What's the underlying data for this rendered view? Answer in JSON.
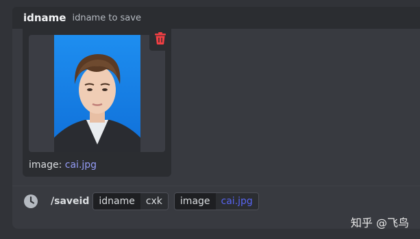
{
  "option_header": {
    "name": "idname",
    "description": "idname to save"
  },
  "attachment": {
    "caption_label": "image:",
    "caption_file": "cai.jpg"
  },
  "delete": {
    "icon": "trash-icon",
    "color": "#f23f43"
  },
  "command": {
    "icon": "clock-icon",
    "name": "/saveid",
    "options": [
      {
        "key": "idname",
        "value": "cxk"
      },
      {
        "key": "image",
        "value": "cai.jpg"
      }
    ]
  },
  "watermark": "知乎 @飞鸟",
  "colors": {
    "background": "#313338",
    "panel": "#383a40",
    "link": "#949cf7",
    "accent": "#5865f2"
  }
}
